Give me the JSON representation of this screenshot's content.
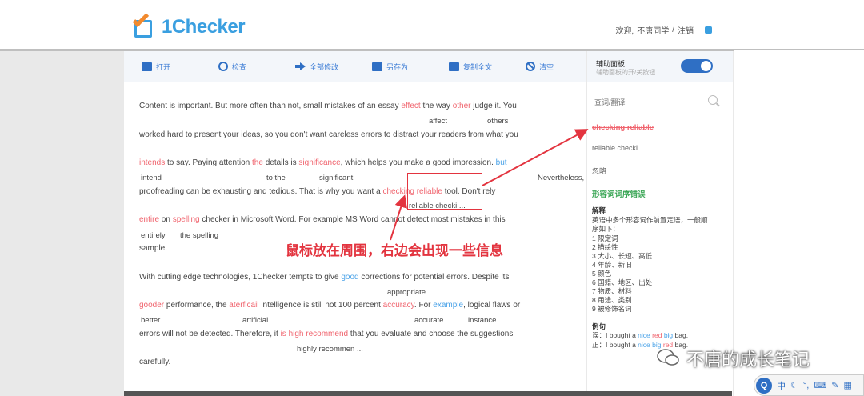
{
  "header": {
    "logo_text": "1Checker",
    "welcome": "欢迎,",
    "username": "不唐同学",
    "separator": "/",
    "logout": "注销"
  },
  "toolbar": {
    "open": "打开",
    "check": "检查",
    "modify_all": "全部修改",
    "save_as": "另存为",
    "copy_all": "复制全文",
    "clear": "清空"
  },
  "document": {
    "l1": [
      "Content is important. But more often than not, small mistakes of an essay ",
      "effect",
      " the way ",
      "other",
      " judge it. You"
    ],
    "s1a": "affect",
    "s1b": "others",
    "l2": "worked hard to present your ideas, so you don't want careless errors to distract your readers from what you",
    "l3": [
      "intends",
      " to say. Paying attention ",
      "the",
      " details is ",
      "significance",
      ", which helps you make a good impression. ",
      "but"
    ],
    "s3a": "intend",
    "s3b": "to the",
    "s3c": "significant",
    "s3d": "Nevertheless,",
    "l4": [
      "proofreading can be exhausting and tedious. That is why you want a ",
      "checking reliable",
      " tool. Don't rely"
    ],
    "s4a": "reliable checki ...",
    "l5": [
      "entire",
      " on ",
      "spelling",
      " checker in Microsoft Word. For example MS Word cannot detect most mistakes in this"
    ],
    "s5a": "entirely",
    "s5b": "the spelling",
    "l6": "sample.",
    "l7": [
      "With cutting edge technologies, 1Checker tempts to give ",
      "good",
      " corrections for potential errors. Despite its"
    ],
    "s7a": "appropriate",
    "l8": [
      "gooder",
      " performance, the ",
      "aterficail",
      " intelligence is still not 100 percent ",
      "accuracy",
      ". For ",
      "example",
      ", logical flaws or"
    ],
    "s8a": "better",
    "s8b": "artificial",
    "s8c": "accurate",
    "s8d": "instance",
    "l9": [
      "errors will not be detected. Therefore, it ",
      "is high",
      "  ",
      "recommend",
      " that you evaluate and choose the suggestions"
    ],
    "s9a": "highly recommen ...",
    "l10": "carefully."
  },
  "sidebar": {
    "assist_title": "辅助面板",
    "assist_sub": "辅助面板的开/关按钮",
    "search_placeholder": "查词/翻译",
    "error_text": "checking reliable",
    "suggestion": "reliable checki...",
    "ignore": "忽略",
    "type": "形容词词序错误",
    "explain_h": "解释",
    "explain_1": "英语中多个形容词作前置定语，一般顺",
    "explain_2": "序如下：",
    "list": [
      "1  限定词",
      "2  描绘性",
      "3  大小、长短、高低",
      "4  年龄、新旧",
      "5  颜色",
      "6  国籍、地区、出处",
      "7  物质、材料",
      "8  用途、类别",
      "9  被修饰名词"
    ],
    "example_h": "例句",
    "ex_wrong_label": "误：I bought a ",
    "ex_wrong_words": [
      "nice",
      " ",
      "red",
      " ",
      "big",
      " bag."
    ],
    "ex_right_label": "正：I bought a ",
    "ex_right_words": [
      "nice",
      " ",
      "big",
      " ",
      "red",
      " bag."
    ]
  },
  "annotation": {
    "text": "鼠标放在周围，右边会出现一些信息"
  },
  "watermark": {
    "text": "不唐的成长笔记"
  },
  "ime": {
    "q": "Q",
    "lang": "中"
  },
  "colors": {
    "accent": "#2f6fc4",
    "error": "#f0646e",
    "suggestion_blue": "#4ba3e8",
    "annotation_red": "#e3343f"
  }
}
